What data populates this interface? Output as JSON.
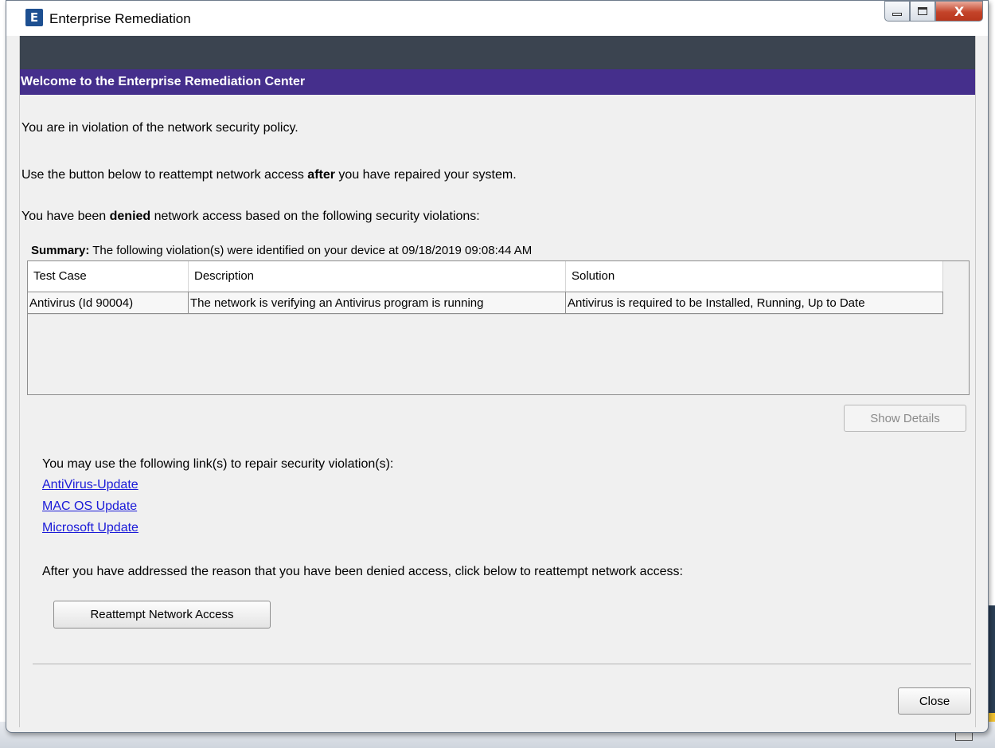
{
  "window": {
    "title": "Enterprise Remediation",
    "icon_letter": "E",
    "close_glyph": "X"
  },
  "header": {
    "welcome": "Welcome to the Enterprise Remediation Center"
  },
  "messages": {
    "violation": "You are in violation of the network security policy.",
    "reattempt_pre": "Use the button below to reattempt network access ",
    "reattempt_bold": "after",
    "reattempt_post": " you have repaired your system.",
    "denied_pre": "You have been ",
    "denied_bold": "denied",
    "denied_post": " network access based on the following security violations:"
  },
  "summary": {
    "label": "Summary:",
    "text": " The following violation(s) were identified on your device at 09/18/2019 09:08:44 AM"
  },
  "table": {
    "columns": [
      "Test Case",
      "Description",
      "Solution"
    ],
    "rows": [
      [
        "Antivirus (Id 90004)",
        "The network is verifying an Antivirus program is running",
        "Antivirus is required to be Installed, Running, Up to Date"
      ]
    ]
  },
  "buttons": {
    "show_details": "Show Details",
    "reattempt": "Reattempt Network Access",
    "close": "Close"
  },
  "links": {
    "intro": "You may use the following link(s) to repair security violation(s):",
    "items": [
      "AntiVirus-Update",
      "MAC OS Update",
      "Microsoft Update"
    ]
  },
  "footer": {
    "after_text": "After you have addressed the reason that you have been denied access, click below to reattempt network access:"
  },
  "colors": {
    "header_dark": "#3b4450",
    "header_purple": "#452f8c",
    "link": "#1a1ad8"
  }
}
